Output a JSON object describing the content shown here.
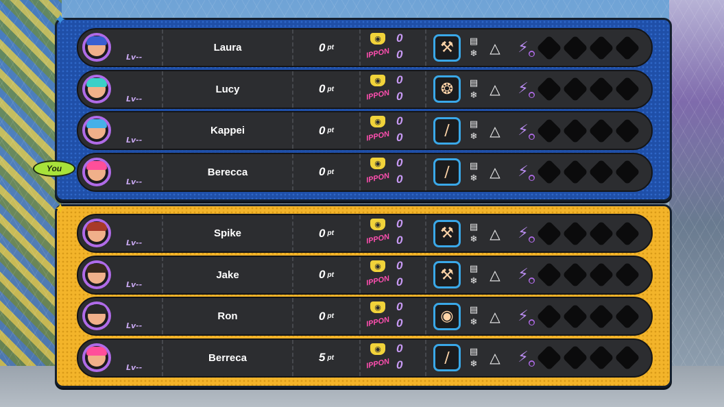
{
  "you_label": "You",
  "lv_label": "Lv--",
  "pt_unit": "pt",
  "ippon_label": "IPPON",
  "teams": {
    "blue": {
      "color": "#1f4fa8",
      "players": [
        {
          "name": "Laura",
          "points": "0",
          "ippon_top": "0",
          "ippon_bottom": "0",
          "weapon": "hammer",
          "hair": "#3a5fd0"
        },
        {
          "name": "Lucy",
          "points": "0",
          "ippon_top": "0",
          "ippon_bottom": "0",
          "weapon": "fan",
          "hair": "#3ad0c8"
        },
        {
          "name": "Kappei",
          "points": "0",
          "ippon_top": "0",
          "ippon_bottom": "0",
          "weapon": "bat",
          "hair": "#46b0e8"
        },
        {
          "name": "Berecca",
          "points": "0",
          "ippon_top": "0",
          "ippon_bottom": "0",
          "weapon": "bat",
          "hair": "#ff4f9a"
        }
      ]
    },
    "yellow": {
      "color": "#f3b42a",
      "players": [
        {
          "name": "Spike",
          "points": "0",
          "ippon_top": "0",
          "ippon_bottom": "0",
          "weapon": "hammer",
          "hair": "#a83a2a"
        },
        {
          "name": "Jake",
          "points": "0",
          "ippon_top": "0",
          "ippon_bottom": "0",
          "weapon": "hammer",
          "hair": "#3a2a1e"
        },
        {
          "name": "Ron",
          "points": "0",
          "ippon_top": "0",
          "ippon_bottom": "0",
          "weapon": "ball",
          "hair": "#2a2a2a"
        },
        {
          "name": "Berreca",
          "points": "5",
          "ippon_top": "0",
          "ippon_bottom": "0",
          "weapon": "bat",
          "hair": "#ff4f9a"
        }
      ]
    }
  }
}
